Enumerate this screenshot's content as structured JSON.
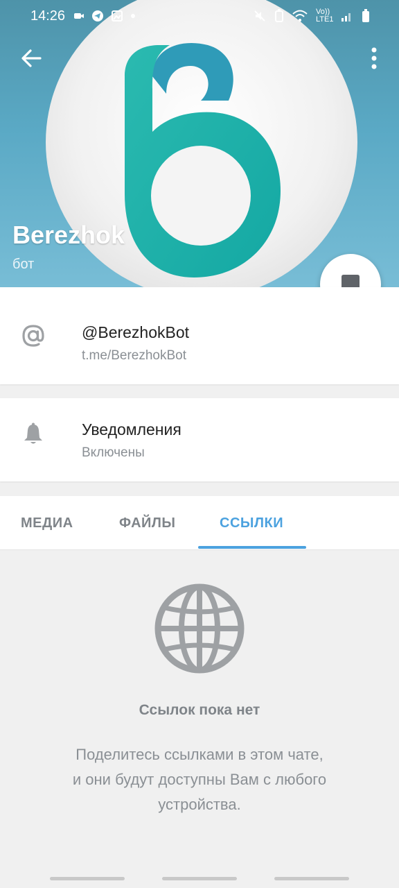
{
  "status_bar": {
    "time": "14:26",
    "network_label": "Vo)) LTE1"
  },
  "header": {
    "bot_name": "Berezhok",
    "subtitle": "бот"
  },
  "username_row": {
    "username": "@BerezhokBot",
    "link": "t.me/BerezhokBot"
  },
  "notifications_row": {
    "title": "Уведомления",
    "status": "Включены"
  },
  "tabs": [
    {
      "label": "МЕДИА",
      "active": false
    },
    {
      "label": "ФАЙЛЫ",
      "active": false
    },
    {
      "label": "ССЫЛКИ",
      "active": true
    }
  ],
  "empty_state": {
    "title": "Ссылок пока нет",
    "line1": "Поделитесь ссылками в этом чате,",
    "line2": "и они будут доступны Вам с любого",
    "line3": "устройства."
  },
  "colors": {
    "accent": "#4ca2df",
    "header_bg": "#5aa9c5",
    "logo_teal": "#1fb3ab",
    "icon_gray": "#9ea1a4"
  },
  "icons": {
    "back": "arrow-left-icon",
    "menu": "more-vertical-icon",
    "message": "message-icon",
    "at": "at-sign-icon",
    "bell": "bell-icon",
    "globe": "globe-icon"
  }
}
